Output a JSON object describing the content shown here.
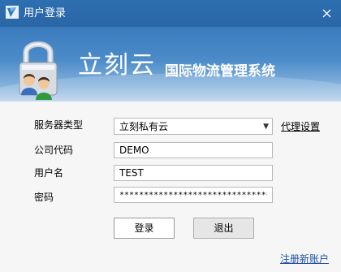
{
  "window": {
    "title": "用户登录",
    "close_glyph": "✕"
  },
  "banner": {
    "brand": "立刻云",
    "system_name": "国际物流管理系统"
  },
  "form": {
    "server_type": {
      "label": "服务器类型",
      "selected": "立刻私有云"
    },
    "proxy_settings": "代理设置",
    "company_code": {
      "label": "公司代码",
      "value": "DEMO"
    },
    "username": {
      "label": "用户名",
      "value": "TEST"
    },
    "password": {
      "label": "密码",
      "value": "********************************"
    }
  },
  "buttons": {
    "login": "登录",
    "exit": "退出"
  },
  "register_link": "注册新账户",
  "colors": {
    "titlebar": "#2d6fb0",
    "banner_top": "#3a7bbd",
    "banner_bottom": "#b8d2ec",
    "link": "#1a4ea8"
  },
  "icons": [
    "app-icon",
    "close-icon",
    "lock-users-icon",
    "chevron-down-icon"
  ]
}
